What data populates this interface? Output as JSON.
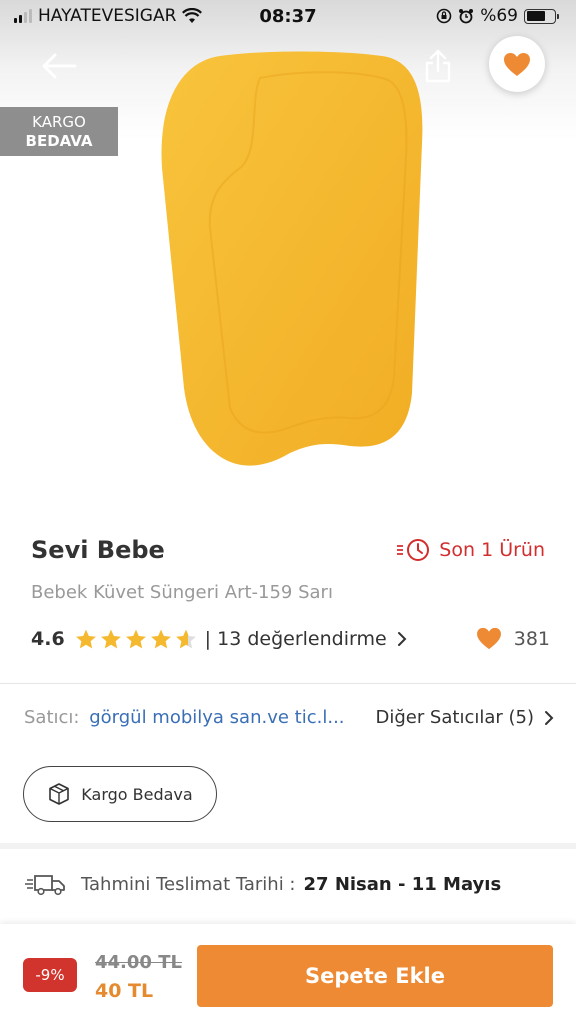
{
  "status_bar": {
    "carrier": "HAYATEVESIGAR",
    "time": "08:37",
    "battery": "%69",
    "battery_level": 0.69
  },
  "header": {
    "back_icon": "arrow-left-icon",
    "share_icon": "share-icon",
    "favorite_icon": "heart-filled-icon"
  },
  "badge": {
    "line1": "KARGO",
    "line2": "BEDAVA"
  },
  "product": {
    "brand": "Sevi Bebe",
    "name": "Bebek Küvet Süngeri Art-159 Sarı",
    "stock_text": "Son 1 Ürün",
    "rating": "4.6",
    "rating_value": 4.6,
    "reviews_text": "| 13 değerlendirme",
    "favorites": "381"
  },
  "seller": {
    "label": "Satıcı:",
    "name": "görgül mobilya san.ve tic.l...",
    "other_sellers": "Diğer Satıcılar (5)"
  },
  "shipping": {
    "label": "Kargo Bedava"
  },
  "delivery": {
    "label": "Tahmini Teslimat Tarihi :",
    "date": "27 Nisan - 11 Mayıs"
  },
  "price": {
    "discount": "-9%",
    "old": "44.00 TL",
    "new": "40 TL",
    "button": "Sepete Ekle"
  },
  "colors": {
    "accent": "#ee8a34",
    "danger": "#d22e2e",
    "link": "#3a6fb6",
    "product": "#f5b92f"
  }
}
